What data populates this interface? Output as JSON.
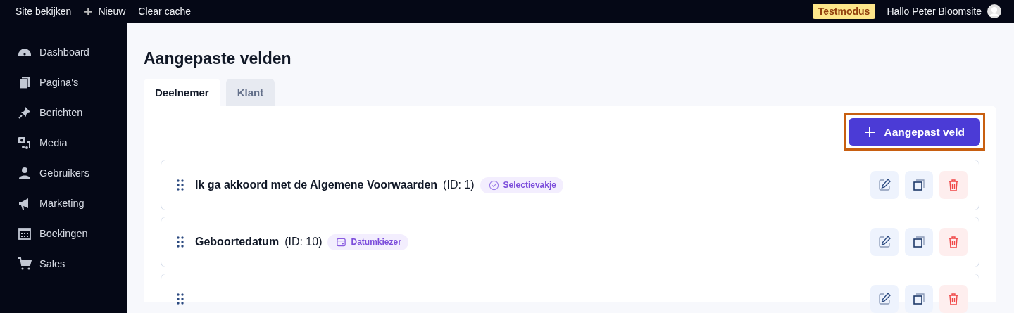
{
  "top_bar": {
    "links": [
      {
        "label": "Site bekijken",
        "kind": "plain"
      },
      {
        "label": "Nieuw",
        "kind": "add"
      },
      {
        "label": "Clear cache",
        "kind": "plain"
      }
    ],
    "mode_badge": "Testmodus",
    "greeting": "Hallo Peter Bloomsite"
  },
  "sidebar": {
    "items": [
      {
        "label": "Dashboard"
      },
      {
        "label": "Pagina's"
      },
      {
        "label": "Berichten"
      },
      {
        "label": "Media"
      },
      {
        "label": "Gebruikers"
      },
      {
        "label": "Marketing"
      },
      {
        "label": "Boekingen"
      },
      {
        "label": "Sales"
      }
    ]
  },
  "page": {
    "title": "Aangepaste velden",
    "tabs": [
      {
        "label": "Deelnemer",
        "selected": true
      },
      {
        "label": "Klant",
        "selected": false
      }
    ],
    "add_button": {
      "label": "Aangepast veld",
      "highlighted": true
    },
    "fields": [
      {
        "kind": "checkbox",
        "title": "Ik ga akkoord met de Algemene Voorwaarden",
        "id": "(ID: 1)",
        "type": "Selectievakje"
      },
      {
        "kind": "date",
        "title": "Geboortedatum",
        "id": "(ID: 10)",
        "type": "Datumkiezer"
      },
      {
        "kind": "partial"
      }
    ]
  }
}
